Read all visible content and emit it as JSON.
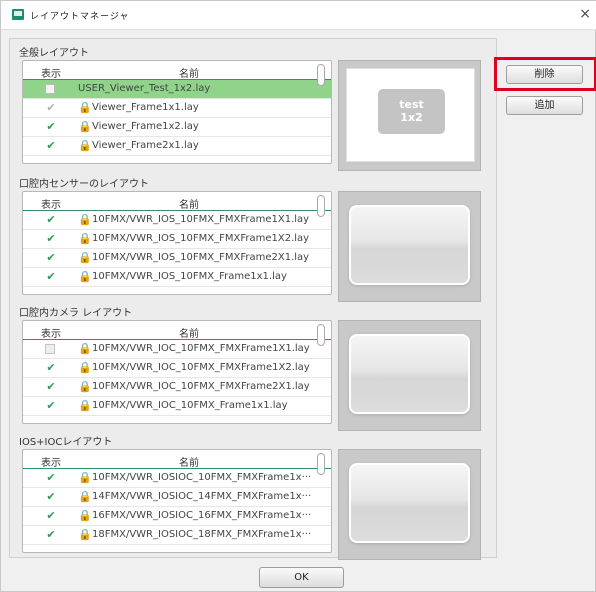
{
  "window": {
    "title": "レイアウトマネージャ",
    "close_glyph": "×"
  },
  "header": {
    "show": "表示",
    "name": "名前"
  },
  "sections": [
    {
      "label": "全般レイアウト",
      "rows": [
        {
          "check": "none",
          "locked": false,
          "selected": true,
          "name": "USER_Viewer_Test_1x2.lay"
        },
        {
          "check": "gray",
          "locked": true,
          "selected": false,
          "name": "Viewer_Frame1x1.lay"
        },
        {
          "check": "green",
          "locked": true,
          "selected": false,
          "name": "Viewer_Frame1x2.lay"
        },
        {
          "check": "green",
          "locked": true,
          "selected": false,
          "name": "Viewer_Frame2x1.lay"
        }
      ],
      "preview_text_line1": "test",
      "preview_text_line2": "1x2"
    },
    {
      "label": "口腔内センサーのレイアウト",
      "rows": [
        {
          "check": "green",
          "locked": true,
          "selected": false,
          "name": "10FMX/VWR_IOS_10FMX_FMXFrame1X1.lay"
        },
        {
          "check": "green",
          "locked": true,
          "selected": false,
          "name": "10FMX/VWR_IOS_10FMX_FMXFrame1X2.lay"
        },
        {
          "check": "green",
          "locked": true,
          "selected": false,
          "name": "10FMX/VWR_IOS_10FMX_FMXFrame2X1.lay"
        },
        {
          "check": "green",
          "locked": true,
          "selected": false,
          "name": "10FMX/VWR_IOS_10FMX_Frame1x1.lay"
        }
      ]
    },
    {
      "label": "口腔内カメラ レイアウト",
      "rows": [
        {
          "check": "box",
          "locked": true,
          "selected": false,
          "name": "10FMX/VWR_IOC_10FMX_FMXFrame1X1.lay"
        },
        {
          "check": "green",
          "locked": true,
          "selected": false,
          "name": "10FMX/VWR_IOC_10FMX_FMXFrame1X2.lay"
        },
        {
          "check": "green",
          "locked": true,
          "selected": false,
          "name": "10FMX/VWR_IOC_10FMX_FMXFrame2X1.lay"
        },
        {
          "check": "green",
          "locked": true,
          "selected": false,
          "name": "10FMX/VWR_IOC_10FMX_Frame1x1.lay"
        }
      ]
    },
    {
      "label": "IOS+IOCレイアウト",
      "rows": [
        {
          "check": "green",
          "locked": true,
          "selected": false,
          "name": "10FMX/VWR_IOSIOC_10FMX_FMXFrame1x···"
        },
        {
          "check": "green",
          "locked": true,
          "selected": false,
          "name": "14FMX/VWR_IOSIOC_14FMX_FMXFrame1x···"
        },
        {
          "check": "green",
          "locked": true,
          "selected": false,
          "name": "16FMX/VWR_IOSIOC_16FMX_FMXFrame1x···"
        },
        {
          "check": "green",
          "locked": true,
          "selected": false,
          "name": "18FMX/VWR_IOSIOC_18FMX_FMXFrame1x···"
        }
      ]
    }
  ],
  "buttons": {
    "delete": "削除",
    "add": "追加",
    "ok": "OK"
  },
  "glyphs": {
    "check": "✔",
    "lock": "🔒"
  },
  "colors": {
    "selected_row": "#8fd48a",
    "check_green": "#2d9b56",
    "header_rule": "#2f8f6f",
    "highlight_frame": "#e0001b"
  }
}
